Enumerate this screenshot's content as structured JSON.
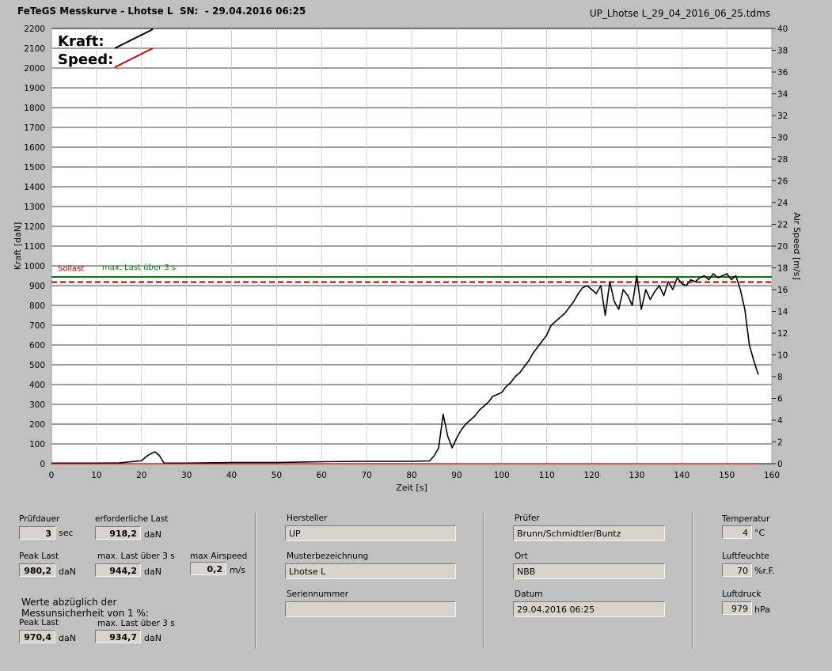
{
  "header": {
    "title": "FeTeGS Messkurve - Lhotse L  SN:  - 29.04.2016 06:25",
    "filename": "UP_Lhotse L_29_04_2016_06_25.tdms"
  },
  "legend": {
    "kraft": "Kraft:",
    "speed": "Speed:"
  },
  "colors": {
    "kraft": "#000000",
    "speed": "#cc0000",
    "sollast": "#aa0000",
    "maxlast": "#008000"
  },
  "chart_data": {
    "type": "line",
    "xlabel": "Zeit [s]",
    "ylabel": "Kraft [daN]",
    "y2label": "Air Speed [m/s]",
    "xlim": [
      0,
      160
    ],
    "ylim": [
      0,
      2200
    ],
    "y2lim": [
      0,
      40
    ],
    "xticks": [
      0,
      10,
      20,
      30,
      40,
      50,
      60,
      70,
      80,
      90,
      100,
      110,
      120,
      130,
      140,
      150,
      160
    ],
    "yticks": [
      0,
      100,
      200,
      300,
      400,
      500,
      600,
      700,
      800,
      900,
      1000,
      1100,
      1200,
      1300,
      1400,
      1500,
      1600,
      1700,
      1800,
      1900,
      2000,
      2100,
      2200
    ],
    "y2ticks": [
      0,
      2,
      4,
      6,
      8,
      10,
      12,
      14,
      16,
      18,
      20,
      22,
      24,
      26,
      28,
      30,
      32,
      34,
      36,
      38,
      40
    ],
    "grid": true,
    "reference_lines": [
      {
        "name": "Sollast",
        "value": 918.2,
        "style": "dashed",
        "color": "#aa0000"
      },
      {
        "name": "max. Last über  3 s",
        "value": 944.2,
        "style": "solid",
        "color": "#008000"
      }
    ],
    "series": [
      {
        "name": "Kraft",
        "axis": "left",
        "x": [
          0,
          5,
          10,
          15,
          20,
          21,
          22,
          23,
          24,
          25,
          30,
          40,
          50,
          60,
          70,
          80,
          84,
          85,
          86,
          87,
          88,
          89,
          90,
          91,
          92,
          93,
          94,
          95,
          96,
          97,
          98,
          99,
          100,
          101,
          102,
          103,
          104,
          105,
          106,
          107,
          108,
          109,
          110,
          111,
          112,
          113,
          114,
          115,
          116,
          117,
          118,
          119,
          120,
          121,
          122,
          123,
          124,
          125,
          126,
          127,
          128,
          129,
          130,
          131,
          132,
          133,
          134,
          135,
          136,
          137,
          138,
          139,
          140,
          141,
          142,
          143,
          144,
          145,
          146,
          147,
          148,
          149,
          150,
          151,
          152,
          153,
          154,
          155,
          156,
          157
        ],
        "values": [
          3,
          3,
          3,
          4,
          15,
          35,
          50,
          60,
          40,
          3,
          3,
          6,
          6,
          10,
          12,
          12,
          14,
          40,
          80,
          250,
          140,
          80,
          130,
          170,
          200,
          220,
          240,
          270,
          290,
          310,
          340,
          350,
          360,
          390,
          410,
          440,
          460,
          490,
          520,
          560,
          590,
          620,
          650,
          700,
          720,
          740,
          760,
          790,
          820,
          860,
          890,
          900,
          880,
          860,
          900,
          750,
          920,
          820,
          780,
          880,
          850,
          800,
          950,
          780,
          880,
          830,
          870,
          900,
          850,
          920,
          880,
          940,
          910,
          900,
          930,
          920,
          940,
          950,
          930,
          960,
          940,
          950,
          960,
          930,
          950,
          880,
          780,
          600,
          520,
          450
        ]
      },
      {
        "name": "Speed",
        "axis": "right",
        "x": [
          0,
          157
        ],
        "values": [
          0,
          0
        ]
      }
    ]
  },
  "info": {
    "pruefdauer": {
      "label": "Prüfdauer",
      "value": "3",
      "unit": "sec"
    },
    "erforderliche_last": {
      "label": "erforderliche Last",
      "value": "918,2",
      "unit": "daN"
    },
    "peak_last": {
      "label": "Peak Last",
      "value": "980,2",
      "unit": "daN"
    },
    "max_last": {
      "label": "max. Last über  3 s",
      "value": "944,2",
      "unit": "daN"
    },
    "max_airspeed": {
      "label": "max Airspeed",
      "value": "0,2",
      "unit": "m/s"
    },
    "werte_text_1": "Werte abzüglich der",
    "werte_text_2": "Messunsicherheit von 1  %:",
    "peak_last_corr": {
      "label": "Peak Last",
      "value": "970,4",
      "unit": "daN"
    },
    "max_last_corr": {
      "label": "max. Last über  3 s",
      "value": "934,7",
      "unit": "daN"
    }
  },
  "fields": {
    "hersteller": {
      "label": "Hersteller",
      "value": "UP"
    },
    "musterbezeichnung": {
      "label": "Musterbezeichnung",
      "value": "Lhotse L"
    },
    "seriennummer": {
      "label": "Seriennummer",
      "value": ""
    },
    "pruefer": {
      "label": "Prüfer",
      "value": "Brunn/Schmidtler/Buntz"
    },
    "ort": {
      "label": "Ort",
      "value": "NBB"
    },
    "datum": {
      "label": "Datum",
      "value": "29.04.2016 06:25"
    }
  },
  "env": {
    "temperatur": {
      "label": "Temperatur",
      "value": "4",
      "unit": "°C"
    },
    "luftfeuchte": {
      "label": "Luftfeuchte",
      "value": "70",
      "unit": "%r.F."
    },
    "luftdruck": {
      "label": "Luftdruck",
      "value": "979",
      "unit": "hPa"
    }
  }
}
